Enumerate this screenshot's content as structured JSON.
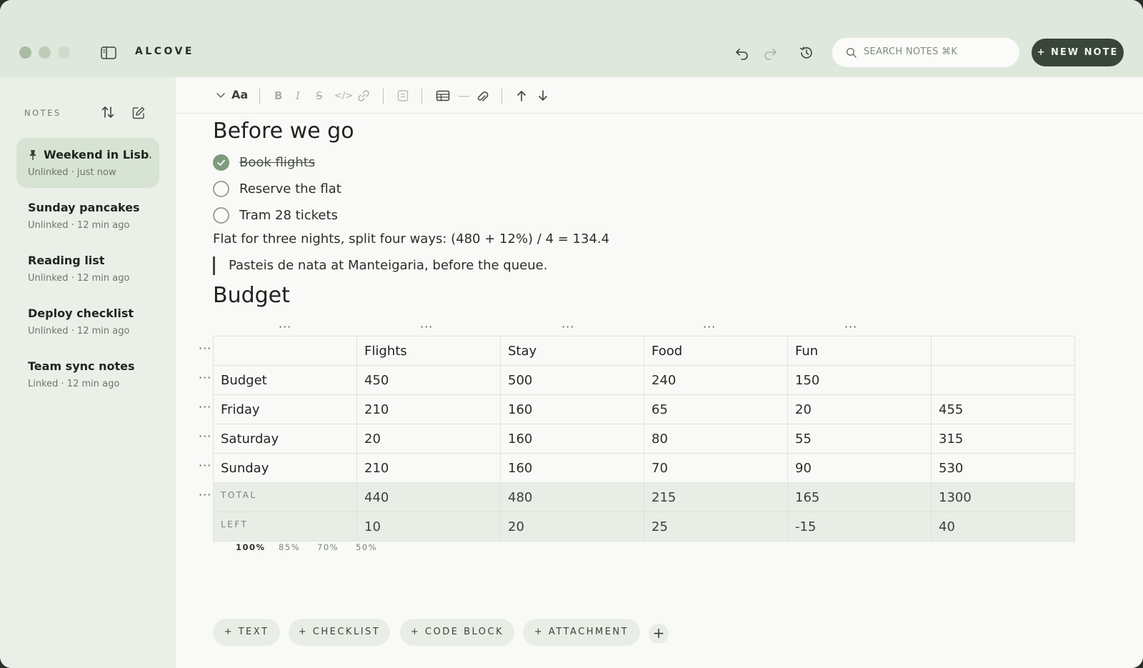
{
  "app": {
    "name": "ALCOVE",
    "search_placeholder": "SEARCH NOTES ⌘K",
    "new_note_label": "+ NEW NOTE"
  },
  "sidebar": {
    "label": "NOTES",
    "notes": [
      {
        "title": "Weekend in Lisb...",
        "meta": "Unlinked · just now",
        "pinned": true,
        "active": true
      },
      {
        "title": "Sunday pancakes",
        "meta": "Unlinked · 12 min ago"
      },
      {
        "title": "Reading list",
        "meta": "Unlinked · 12 min ago"
      },
      {
        "title": "Deploy checklist",
        "meta": "Unlinked · 12 min ago"
      },
      {
        "title": "Team sync notes",
        "meta": "Linked · 12 min ago"
      }
    ]
  },
  "toolbar": {
    "text_style": "Aa",
    "bold": "B",
    "italic": "I",
    "strike": "S",
    "code": "</>",
    "divider": "—"
  },
  "doc": {
    "heading1": "Before we go",
    "checklist": [
      {
        "label": "Book flights",
        "checked": true
      },
      {
        "label": "Reserve the flat",
        "checked": false
      },
      {
        "label": "Tram 28 tickets",
        "checked": false
      }
    ],
    "paragraph": "Flat for three nights, split four ways: (480 + 12%) / 4 = 134.4",
    "quote": "Pasteis de nata at Manteigaria, before the queue.",
    "heading2": "Budget",
    "handle": "···",
    "table": {
      "header": [
        "",
        "Flights",
        "Stay",
        "Food",
        "Fun",
        ""
      ],
      "rows": [
        [
          "Budget",
          "450",
          "500",
          "240",
          "150",
          ""
        ],
        [
          "Friday",
          "210",
          "160",
          "65",
          "20",
          "455"
        ],
        [
          "Saturday",
          "20",
          "160",
          "80",
          "55",
          "315"
        ],
        [
          "Sunday",
          "210",
          "160",
          "70",
          "90",
          "530"
        ]
      ],
      "total": [
        "TOTAL",
        "440",
        "480",
        "215",
        "165",
        "1300"
      ],
      "left": [
        "LEFT",
        "10",
        "20",
        "25",
        "-15",
        "40"
      ]
    },
    "zoom_options": [
      "100%",
      "85%",
      "70%",
      "50%"
    ],
    "zoom_selected": "100%"
  },
  "insert_bar": {
    "text": "+ TEXT",
    "checklist": "+ CHECKLIST",
    "code_block": "+ CODE BLOCK",
    "attachment": "+ ATTACHMENT",
    "more": "+"
  },
  "colors": {
    "titlebar": "#dfe8dc",
    "sidebar": "#eaf0e8",
    "accent": "#3a463a",
    "negative": "#b4584a"
  }
}
